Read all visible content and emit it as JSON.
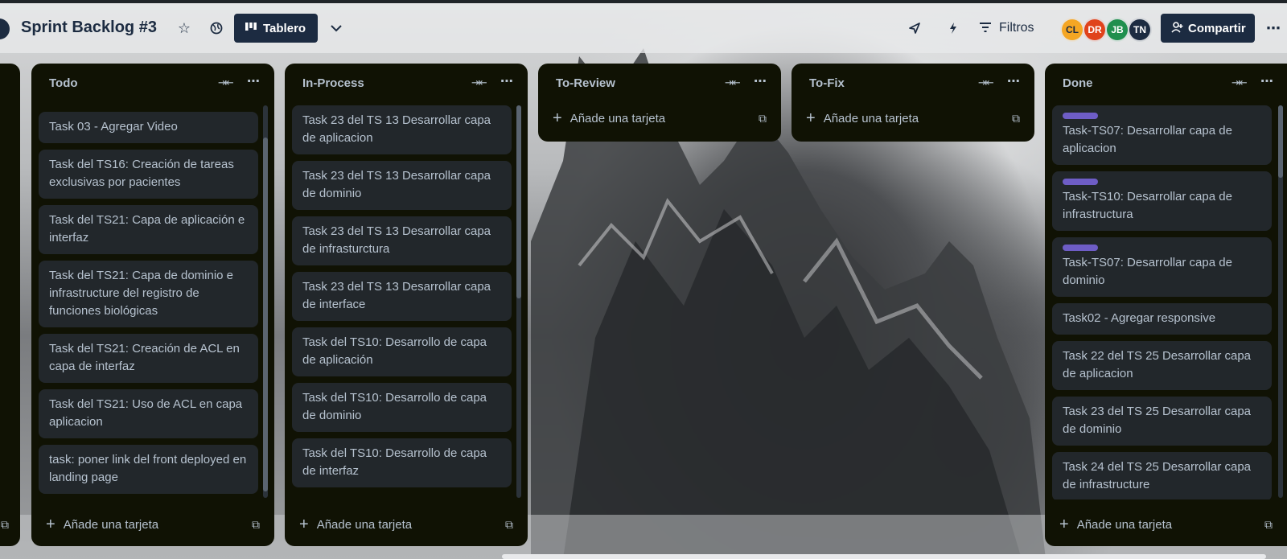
{
  "header": {
    "board_title": "Sprint Backlog #3",
    "view_button": "Tablero",
    "filters_label": "Filtros",
    "share_label": "Compartir",
    "avatars": [
      {
        "initials": "CL",
        "color": "#f5a623"
      },
      {
        "initials": "DR",
        "color": "#e0431b"
      },
      {
        "initials": "JB",
        "color": "#1f8f4e"
      },
      {
        "initials": "TN",
        "color": "#1c2b41"
      }
    ],
    "icons": [
      "star-icon",
      "globe-icon",
      "board-icon",
      "chevron-down-icon",
      "rocket-icon",
      "lightning-icon",
      "filter-icon",
      "add-person-icon",
      "more-icon"
    ]
  },
  "lists": {
    "todo": {
      "title": "Todo",
      "add_label": "Añade una tarjeta",
      "cards": [
        {
          "text": "Task 03 - Agregar Video"
        },
        {
          "text": "Task del TS16: Creación de tareas exclusivas por pacientes"
        },
        {
          "text": "Task del TS21: Capa de aplicación e interfaz"
        },
        {
          "text": "Task del TS21: Capa de dominio e infrastructure del registro de funciones biológicas"
        },
        {
          "text": "Task del TS21: Creación de ACL en capa de interfaz"
        },
        {
          "text": "Task del TS21: Uso de ACL en capa aplicacion"
        },
        {
          "text": "task: poner link del front deployed en landing page"
        }
      ]
    },
    "in_process": {
      "title": "In-Process",
      "add_label": "Añade una tarjeta",
      "cards": [
        {
          "text": "Task 23 del TS 13 Desarrollar capa de aplicacion"
        },
        {
          "text": "Task 23 del TS 13 Desarrollar capa de dominio"
        },
        {
          "text": "Task 23 del TS 13 Desarrollar capa de infrasturctura"
        },
        {
          "text": "Task 23 del TS 13 Desarrollar capa de interface"
        },
        {
          "text": "Task del TS10: Desarrollo de capa de aplicación"
        },
        {
          "text": "Task del TS10: Desarrollo de capa de dominio"
        },
        {
          "text": "Task del TS10: Desarrollo de capa de interfaz"
        }
      ]
    },
    "to_review": {
      "title": "To-Review",
      "add_label": "Añade una tarjeta"
    },
    "to_fix": {
      "title": "To-Fix",
      "add_label": "Añade una tarjeta"
    },
    "done": {
      "title": "Done",
      "add_label": "Añade una tarjeta",
      "label_color": "#6e5dc6",
      "cards": [
        {
          "text": "Task-TS07: Desarrollar capa de aplicacion"
        },
        {
          "text": "Task-TS10: Desarrollar capa de infrastructura"
        },
        {
          "text": "Task-TS07: Desarrollar capa de dominio"
        },
        {
          "text": "Task02 - Agregar responsive"
        },
        {
          "text": "Task 22 del TS 25 Desarrollar capa de aplicacion"
        },
        {
          "text": "Task 23 del TS 25 Desarrollar capa de dominio"
        },
        {
          "text": "Task 24 del TS 25 Desarrollar capa de infrastructure"
        }
      ]
    }
  }
}
